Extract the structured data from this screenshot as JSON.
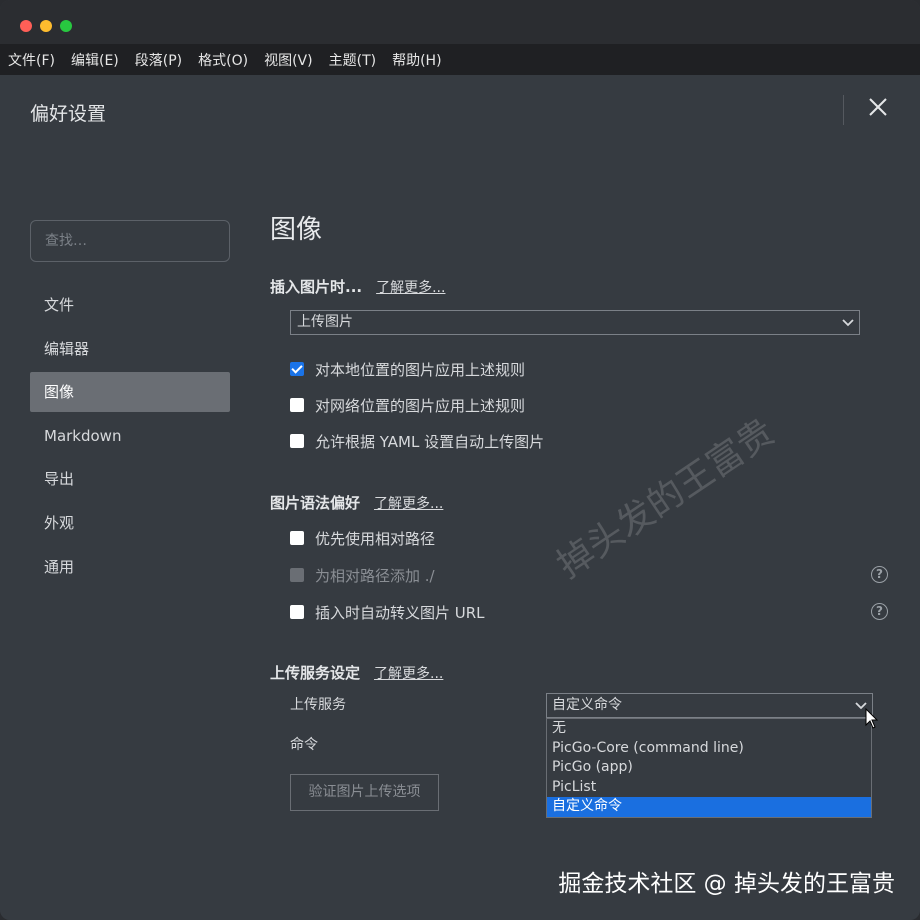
{
  "menubar": {
    "items": [
      "文件(F)",
      "编辑(E)",
      "段落(P)",
      "格式(O)",
      "视图(V)",
      "主题(T)",
      "帮助(H)"
    ]
  },
  "header": {
    "title": "偏好设置",
    "close_icon": "close-icon"
  },
  "search": {
    "placeholder": "查找…"
  },
  "sidebar": {
    "items": [
      {
        "label": "文件",
        "active": false
      },
      {
        "label": "编辑器",
        "active": false
      },
      {
        "label": "图像",
        "active": true
      },
      {
        "label": "Markdown",
        "active": false
      },
      {
        "label": "导出",
        "active": false
      },
      {
        "label": "外观",
        "active": false
      },
      {
        "label": "通用",
        "active": false
      }
    ]
  },
  "main": {
    "title": "图像",
    "insert_section": {
      "heading": "插入图片时...",
      "learn_more": "了解更多...",
      "select_value": "上传图片",
      "options": [
        {
          "label": "对本地位置的图片应用上述规则",
          "checked": true,
          "disabled": false
        },
        {
          "label": "对网络位置的图片应用上述规则",
          "checked": false,
          "disabled": false
        },
        {
          "label": "允许根据 YAML 设置自动上传图片",
          "checked": false,
          "disabled": false
        }
      ]
    },
    "syntax_section": {
      "heading": "图片语法偏好",
      "learn_more": "了解更多...",
      "options": [
        {
          "label": "优先使用相对路径",
          "checked": false,
          "disabled": false
        },
        {
          "label": "为相对路径添加 ./",
          "checked": false,
          "disabled": true
        },
        {
          "label": "插入时自动转义图片 URL",
          "checked": false,
          "disabled": false
        }
      ]
    },
    "upload_section": {
      "heading": "上传服务设定",
      "learn_more": "了解更多...",
      "service_label": "上传服务",
      "service_value": "自定义命令",
      "command_label": "命令",
      "dropdown_options": [
        "无",
        "PicGo-Core (command line)",
        "PicGo (app)",
        "PicList",
        "自定义命令"
      ],
      "dropdown_selected": "自定义命令",
      "verify_button": "验证图片上传选项"
    }
  },
  "watermark": "掉头发的王富贵",
  "footer_mark": "掘金技术社区 @ 掉头发的王富贵",
  "colors": {
    "background": "#363b41",
    "menubar": "#1f2023",
    "active_sidebar": "#6a6e74",
    "accent": "#1a73e8"
  }
}
